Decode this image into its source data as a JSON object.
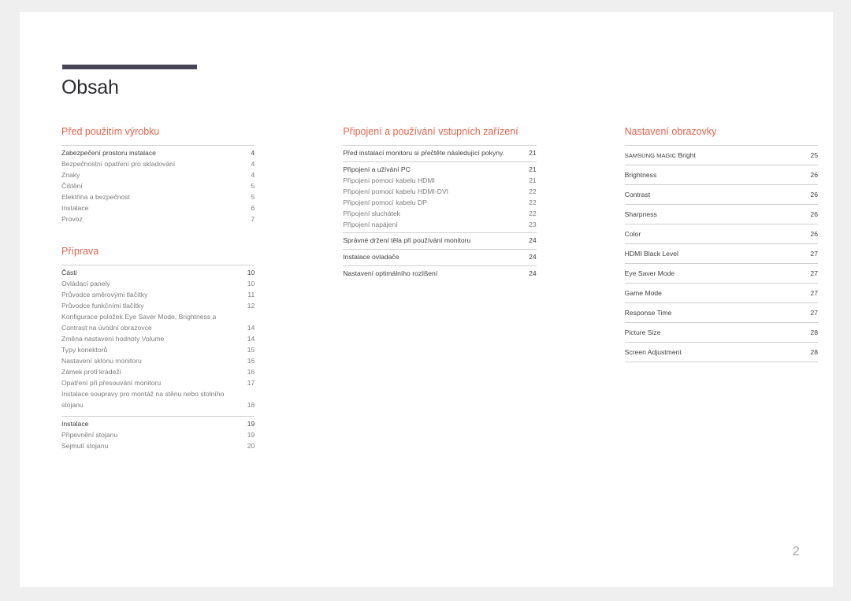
{
  "document": {
    "title": "Obsah",
    "page_number": "2",
    "accent_color": "#e1634f",
    "rule_color": "#474455"
  },
  "columns": [
    {
      "sections": [
        {
          "heading": "Před použitím výrobku",
          "groups": [
            {
              "entries": [
                {
                  "label": "Zabezpečení prostoru instalace",
                  "page": "4",
                  "lead": true
                },
                {
                  "label": "Bezpečnostní opatření pro skladování",
                  "page": "4",
                  "lead": false
                },
                {
                  "label": "Znaky",
                  "page": "4",
                  "lead": false
                },
                {
                  "label": "Čištění",
                  "page": "5",
                  "lead": false
                },
                {
                  "label": "Elektřina a bezpečnost",
                  "page": "5",
                  "lead": false
                },
                {
                  "label": "Instalace",
                  "page": "6",
                  "lead": false
                },
                {
                  "label": "Provoz",
                  "page": "7",
                  "lead": false
                }
              ]
            }
          ]
        },
        {
          "heading": "Příprava",
          "groups": [
            {
              "entries": [
                {
                  "label": "Části",
                  "page": "10",
                  "lead": true
                },
                {
                  "label": "Ovládací panely",
                  "page": "10",
                  "lead": false
                },
                {
                  "label": "Průvodce směrovými tlačítky",
                  "page": "11",
                  "lead": false
                },
                {
                  "label": "Průvodce funkčními tlačítky",
                  "page": "12",
                  "lead": false
                },
                {
                  "label": "Konfigurace položek Eye Saver Mode, Brightness a Contrast na úvodní obrazovce",
                  "page": "14",
                  "lead": false,
                  "wrap": true
                },
                {
                  "label": "Změna nastavení hodnoty Volume",
                  "page": "14",
                  "lead": false
                },
                {
                  "label": "Typy konektorů",
                  "page": "15",
                  "lead": false
                },
                {
                  "label": "Nastavení sklonu monitoru",
                  "page": "16",
                  "lead": false
                },
                {
                  "label": "Zámek proti krádeži",
                  "page": "16",
                  "lead": false
                },
                {
                  "label": "Opatření při přesouvání monitoru",
                  "page": "17",
                  "lead": false
                },
                {
                  "label": "Instalace soupravy pro montáž na stěnu nebo stolního stojanu",
                  "page": "18",
                  "lead": false,
                  "wrap": true
                }
              ]
            },
            {
              "entries": [
                {
                  "label": "Instalace",
                  "page": "19",
                  "lead": true
                },
                {
                  "label": "Připevnění stojanu",
                  "page": "19",
                  "lead": false
                },
                {
                  "label": "Sejmutí stojanu",
                  "page": "20",
                  "lead": false
                }
              ]
            }
          ]
        }
      ]
    },
    {
      "sections": [
        {
          "heading": "Připojení a používání vstupních zařízení",
          "groups": [
            {
              "entries": [
                {
                  "label": "Před instalací monitoru si přečtěte následující pokyny.",
                  "page": "21",
                  "lead": true,
                  "wrap": true
                }
              ]
            },
            {
              "entries": [
                {
                  "label": "Připojení a užívání PC",
                  "page": "21",
                  "lead": true
                },
                {
                  "label": "Připojení pomocí kabelu HDMI",
                  "page": "21",
                  "lead": false
                },
                {
                  "label": "Připojení pomocí kabelu HDMI-DVI",
                  "page": "22",
                  "lead": false
                },
                {
                  "label": "Připojení pomocí kabelu DP",
                  "page": "22",
                  "lead": false
                },
                {
                  "label": "Připojení sluchátek",
                  "page": "22",
                  "lead": false
                },
                {
                  "label": "Připojení napájení",
                  "page": "23",
                  "lead": false
                }
              ]
            },
            {
              "entries": [
                {
                  "label": "Správné držení těla při používání monitoru",
                  "page": "24",
                  "lead": true
                }
              ]
            },
            {
              "entries": [
                {
                  "label": "Instalace ovladače",
                  "page": "24",
                  "lead": true
                }
              ]
            },
            {
              "entries": [
                {
                  "label": "Nastavení optimálního rozlišení",
                  "page": "24",
                  "lead": true
                }
              ]
            }
          ]
        }
      ]
    },
    {
      "sections": [
        {
          "heading": "Nastavení obrazovky",
          "rows": [
            {
              "label_small": "SAMSUNG MAGIC",
              "label": " Bright",
              "page": "25"
            },
            {
              "label": "Brightness",
              "page": "26"
            },
            {
              "label": "Contrast",
              "page": "26"
            },
            {
              "label": "Sharpness",
              "page": "26"
            },
            {
              "label": "Color",
              "page": "26"
            },
            {
              "label": "HDMI Black Level",
              "page": "27"
            },
            {
              "label": "Eye Saver Mode",
              "page": "27"
            },
            {
              "label": "Game Mode",
              "page": "27"
            },
            {
              "label": "Response Time",
              "page": "27"
            },
            {
              "label": "Picture Size",
              "page": "28"
            },
            {
              "label": "Screen Adjustment",
              "page": "28"
            }
          ]
        }
      ]
    }
  ]
}
